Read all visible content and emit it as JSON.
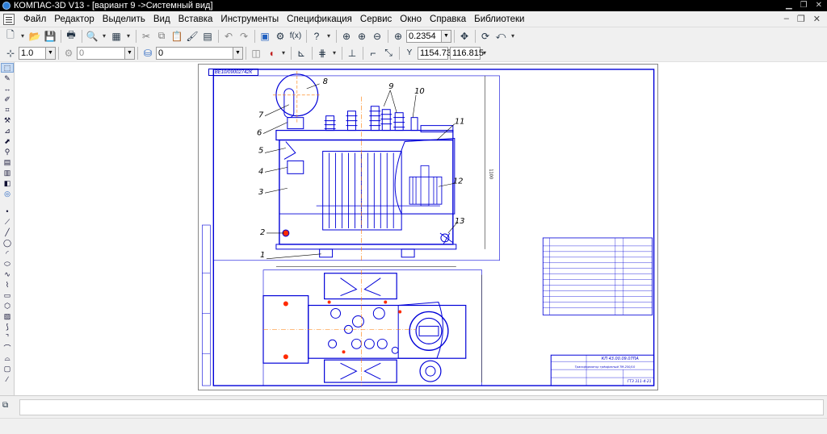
{
  "window": {
    "app": "КОМПАС-3D V13",
    "separator": "-",
    "document": "[вариант 9 ->Системный вид]"
  },
  "menu": [
    "Файл",
    "Редактор",
    "Выделить",
    "Вид",
    "Вставка",
    "Инструменты",
    "Спецификация",
    "Сервис",
    "Окно",
    "Справка",
    "Библиотеки"
  ],
  "toolbar": {
    "zoom_value": "0.2354"
  },
  "props_toolbar": {
    "style_value": "1.0",
    "layer_value": "0",
    "state_value": "0",
    "coord_x": "1154.73",
    "coord_y": "116.815",
    "coord_label": "Y"
  },
  "drawing": {
    "stamp": "ВЕ10/09002742К",
    "callouts": [
      "1",
      "2",
      "3",
      "4",
      "5",
      "6",
      "7",
      "8",
      "9",
      "10",
      "11",
      "12",
      "13"
    ],
    "title_code": "КП 43.00.09.07ПА",
    "title_name": "Трансформатор трёхфазный ТМ-250/10",
    "group": "ГТЗ 311-4-21",
    "dim_label": "1100"
  },
  "colors": {
    "drawing_blue": "#0000d8",
    "axis_orange": "#ff7a00",
    "accent_red": "#ff2a00"
  }
}
